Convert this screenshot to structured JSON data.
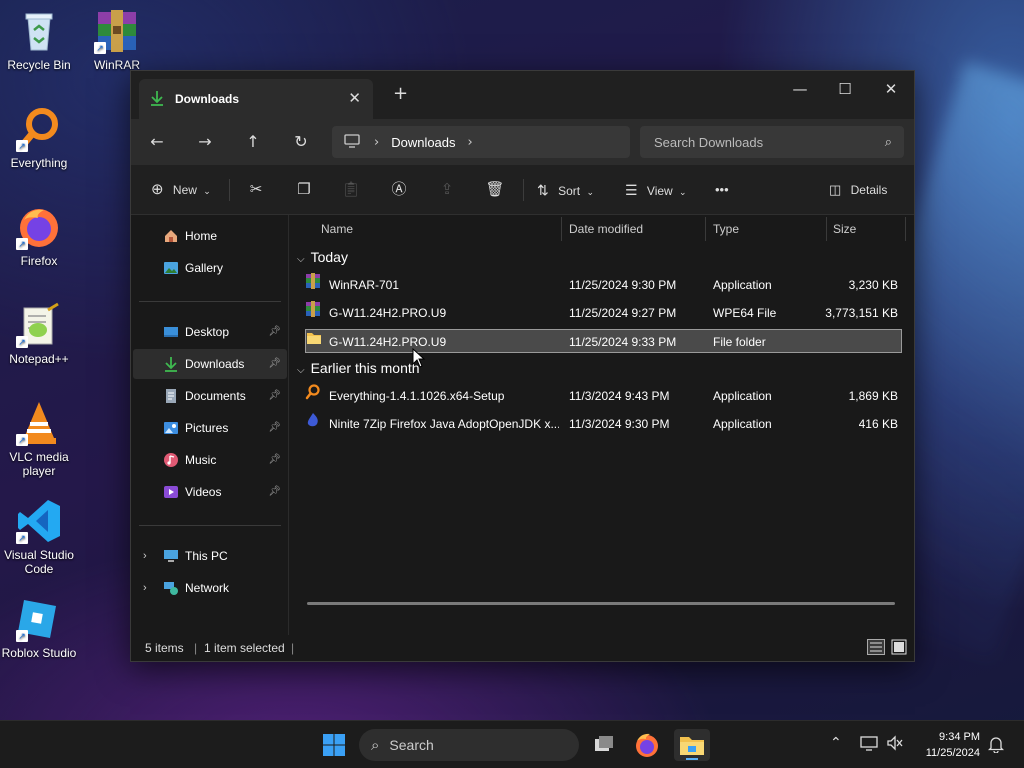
{
  "desktop": {
    "icons": [
      {
        "label": "Recycle Bin",
        "icon": "recycle-bin-icon"
      },
      {
        "label": "WinRAR",
        "icon": "winrar-icon"
      },
      {
        "label": "Everything",
        "icon": "everything-icon"
      },
      {
        "label": "Firefox",
        "icon": "firefox-icon"
      },
      {
        "label": "Notepad++",
        "icon": "notepadpp-icon"
      },
      {
        "label": "VLC media player",
        "icon": "vlc-icon"
      },
      {
        "label": "Visual Studio Code",
        "icon": "vscode-icon"
      },
      {
        "label": "Roblox Studio",
        "icon": "roblox-studio-icon"
      }
    ]
  },
  "window": {
    "tab_title": "Downloads",
    "tab_close": "✕",
    "new_tab": "+",
    "minimize": "—",
    "maximize": "☐",
    "close": "✕"
  },
  "nav": {
    "address_crumb": "Downloads",
    "search_placeholder": "Search Downloads"
  },
  "commands": {
    "new_label": "New",
    "sort_label": "Sort",
    "view_label": "View",
    "more_label": "•••",
    "details_label": "Details"
  },
  "sidebar": {
    "home": "Home",
    "gallery": "Gallery",
    "desktop": "Desktop",
    "downloads": "Downloads",
    "documents": "Documents",
    "pictures": "Pictures",
    "music": "Music",
    "videos": "Videos",
    "this_pc": "This PC",
    "network": "Network"
  },
  "columns": {
    "name": "Name",
    "date": "Date modified",
    "type": "Type",
    "size": "Size"
  },
  "groups": {
    "today": "Today",
    "earlier": "Earlier this month"
  },
  "files": [
    {
      "name": "WinRAR-701",
      "date": "11/25/2024 9:30 PM",
      "type": "Application",
      "size": "3,230 KB"
    },
    {
      "name": "G-W11.24H2.PRO.U9",
      "date": "11/25/2024 9:27 PM",
      "type": "WPE64 File",
      "size": "3,773,151 KB"
    },
    {
      "name": "G-W11.24H2.PRO.U9",
      "date": "11/25/2024 9:33 PM",
      "type": "File folder",
      "size": ""
    },
    {
      "name": "Everything-1.4.1.1026.x64-Setup",
      "date": "11/3/2024 9:43 PM",
      "type": "Application",
      "size": "1,869 KB"
    },
    {
      "name": "Ninite 7Zip Firefox Java AdoptOpenJDK x...",
      "date": "11/3/2024 9:30 PM",
      "type": "Application",
      "size": "416 KB"
    }
  ],
  "status": {
    "items": "5 items",
    "selected": "1 item selected"
  },
  "taskbar": {
    "search_label": "Search",
    "time": "9:34 PM",
    "date": "11/25/2024"
  },
  "colors": {
    "accent": "#0078d4",
    "folder": "#f2c14e"
  }
}
